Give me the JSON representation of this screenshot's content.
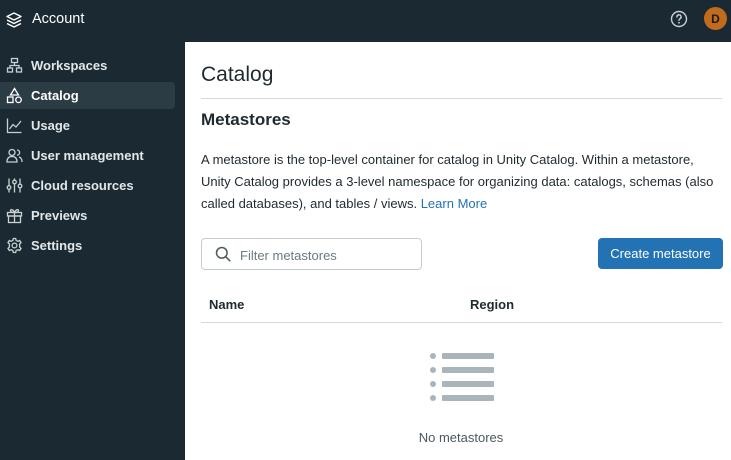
{
  "topbar": {
    "title": "Account",
    "avatar_initial": "D"
  },
  "sidebar": {
    "items": [
      {
        "label": "Workspaces",
        "icon": "workspaces-icon",
        "active": false
      },
      {
        "label": "Catalog",
        "icon": "catalog-icon",
        "active": true
      },
      {
        "label": "Usage",
        "icon": "usage-chart-icon",
        "active": false
      },
      {
        "label": "User management",
        "icon": "users-icon",
        "active": false
      },
      {
        "label": "Cloud resources",
        "icon": "sliders-icon",
        "active": false
      },
      {
        "label": "Previews",
        "icon": "gift-icon",
        "active": false
      },
      {
        "label": "Settings",
        "icon": "gear-icon",
        "active": false
      }
    ]
  },
  "main": {
    "title": "Catalog",
    "section_title": "Metastores",
    "description": "A metastore is the top-level container for catalog in Unity Catalog. Within a metastore, Unity Catalog provides a 3-level namespace for organizing data: catalogs, schemas (also called databases), and tables / views.",
    "learn_more": "Learn More",
    "search_placeholder": "Filter metastores",
    "search_value": "",
    "create_button": "Create metastore",
    "columns": [
      "Name",
      "Region"
    ],
    "rows": [],
    "empty_text": "No metastores"
  },
  "colors": {
    "sidebar_bg": "#1b2a32",
    "accent": "#2272b4",
    "avatar_bg": "#c26b1c"
  }
}
